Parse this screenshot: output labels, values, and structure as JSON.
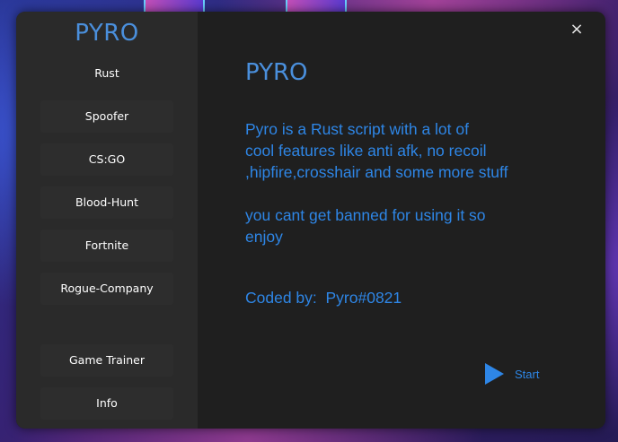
{
  "app": {
    "brand": "PYRO",
    "close_symbol": "×",
    "accent_color": "#2e86e6"
  },
  "sidebar": {
    "items": [
      {
        "label": "Rust"
      },
      {
        "label": "Spoofer"
      },
      {
        "label": "CS:GO"
      },
      {
        "label": "Blood-Hunt"
      },
      {
        "label": "Fortnite"
      },
      {
        "label": "Rogue-Company"
      },
      {
        "label": "Game Trainer"
      },
      {
        "label": "Info"
      }
    ]
  },
  "main": {
    "title": "PYRO",
    "description_lines": [
      "Pyro is a Rust script with a lot of",
      "cool features like anti afk, no recoil",
      ",hipfire,crosshair and some more stuff"
    ],
    "note_lines": [
      "you cant get banned for using it so",
      "enjoy"
    ],
    "credits": "Coded by:  Pyro#0821",
    "start_label": "Start",
    "start_icon": "play-icon"
  }
}
